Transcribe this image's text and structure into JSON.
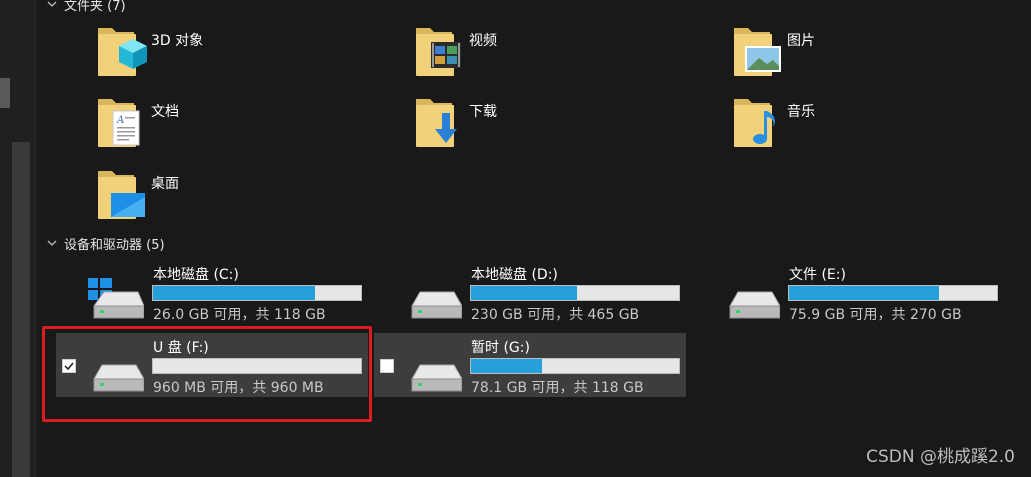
{
  "folders_section": {
    "title": "文件夹 (7)"
  },
  "folders": [
    {
      "label": "3D 对象",
      "icon": "3d-objects-folder-icon"
    },
    {
      "label": "视频",
      "icon": "videos-folder-icon"
    },
    {
      "label": "图片",
      "icon": "pictures-folder-icon"
    },
    {
      "label": "文档",
      "icon": "documents-folder-icon"
    },
    {
      "label": "下载",
      "icon": "downloads-folder-icon"
    },
    {
      "label": "音乐",
      "icon": "music-folder-icon"
    },
    {
      "label": "桌面",
      "icon": "desktop-folder-icon"
    }
  ],
  "drives_section": {
    "title": "设备和驱动器 (5)"
  },
  "drives": [
    {
      "name": "本地磁盘 (C:)",
      "space": "26.0 GB 可用，共 118 GB",
      "used_fraction": 0.78,
      "icon": "windows-drive-icon"
    },
    {
      "name": "本地磁盘 (D:)",
      "space": "230 GB 可用，共 465 GB",
      "used_fraction": 0.51,
      "icon": "hard-drive-icon"
    },
    {
      "name": "文件 (E:)",
      "space": "75.9 GB 可用，共 270 GB",
      "used_fraction": 0.72,
      "icon": "hard-drive-icon"
    },
    {
      "name": "U 盘 (F:)",
      "space": "960 MB 可用，共 960 MB",
      "used_fraction": 0.0,
      "icon": "usb-drive-icon",
      "checked": true
    },
    {
      "name": "暂时 (G:)",
      "space": "78.1 GB 可用，共 118 GB",
      "used_fraction": 0.34,
      "icon": "hard-drive-icon",
      "checked": false
    }
  ],
  "watermark": "CSDN @桃成蹊2.0",
  "colors": {
    "bar_fill": "#26a0da",
    "highlight": "#d81e1e",
    "background": "#191919"
  }
}
